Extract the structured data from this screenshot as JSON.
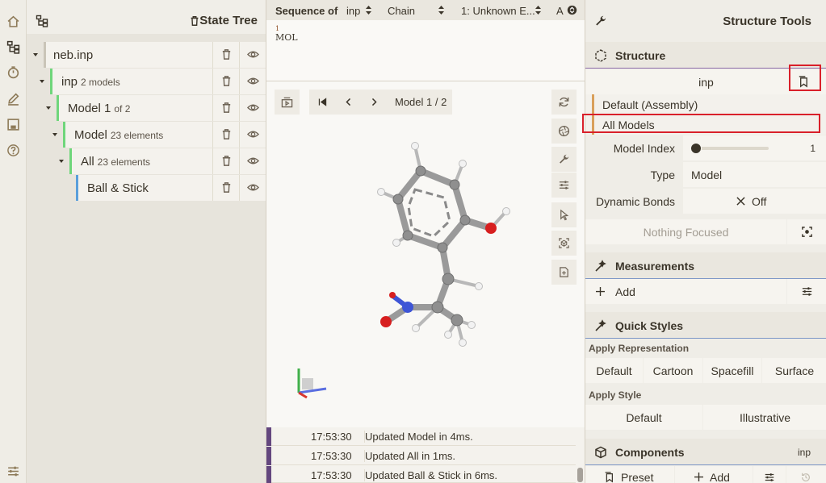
{
  "rail": {
    "icons": [
      "home-icon",
      "tree-icon",
      "timer-icon",
      "pen-icon",
      "save-icon",
      "help-icon",
      "settings-sliders-icon"
    ]
  },
  "state_tree": {
    "title": "State Tree",
    "nodes": [
      {
        "label": "neb.inp",
        "sub": ""
      },
      {
        "label": "inp",
        "sub": "2 models"
      },
      {
        "label": "Model 1",
        "sub": "of 2"
      },
      {
        "label": "Model",
        "sub": "23 elements"
      },
      {
        "label": "All",
        "sub": "23 elements"
      },
      {
        "label": "Ball & Stick",
        "sub": ""
      }
    ]
  },
  "sequence": {
    "label": "Sequence of",
    "structure": "inp",
    "mode": "Chain",
    "entity": "1: Unknown E...",
    "letter": "A",
    "residue_number": "1",
    "residue_text": "MOL"
  },
  "viewport": {
    "model_label": "Model 1 / 2"
  },
  "log": [
    {
      "time": "17:53:30",
      "message": "Updated Model in 4ms."
    },
    {
      "time": "17:53:30",
      "message": "Updated All in 1ms."
    },
    {
      "time": "17:53:30",
      "message": "Updated Ball & Stick in 6ms."
    }
  ],
  "tools": {
    "title": "Structure Tools",
    "structure": {
      "title": "Structure",
      "selected": "inp",
      "options": [
        "Default (Assembly)",
        "All Models"
      ],
      "model_index_label": "Model Index",
      "model_index_value": "1",
      "model_index_fraction": 0,
      "type_label": "Type",
      "type_value": "Model",
      "dynamic_bonds_label": "Dynamic Bonds",
      "dynamic_bonds_value": "Off",
      "focus_text": "Nothing Focused"
    },
    "measurements": {
      "title": "Measurements",
      "add_label": "Add"
    },
    "quick_styles": {
      "title": "Quick Styles",
      "rep_header": "Apply Representation",
      "reps": [
        "Default",
        "Cartoon",
        "Spacefill",
        "Surface"
      ],
      "style_header": "Apply Style",
      "styles": [
        "Default",
        "Illustrative"
      ]
    },
    "components": {
      "title": "Components",
      "structure": "inp",
      "preset_label": "Preset",
      "add_label": "Add"
    }
  },
  "colors": {
    "accent": "#d9202a",
    "tree_bar_green": "#6fd67b",
    "tree_bar_blue": "#5a9fdb",
    "log_bar": "#63467e",
    "brand": "#8d7a58"
  }
}
